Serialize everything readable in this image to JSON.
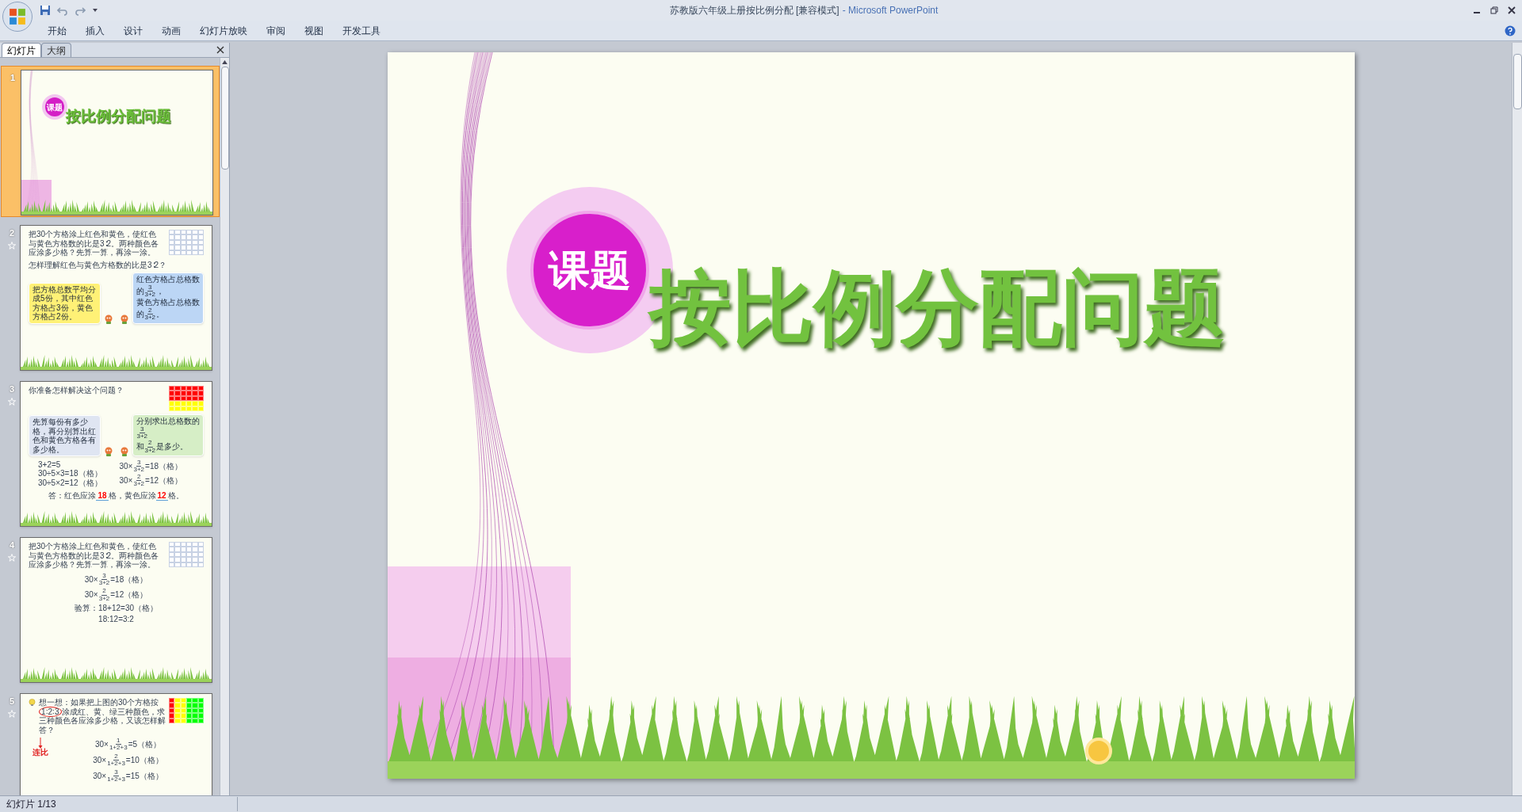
{
  "window": {
    "title": "苏教版六年级上册按比例分配 [兼容模式]",
    "app": "- Microsoft PowerPoint"
  },
  "ribbon_tabs": [
    {
      "label": "开始"
    },
    {
      "label": "插入"
    },
    {
      "label": "设计"
    },
    {
      "label": "动画"
    },
    {
      "label": "幻灯片放映"
    },
    {
      "label": "审阅"
    },
    {
      "label": "视图"
    },
    {
      "label": "开发工具"
    }
  ],
  "panel": {
    "tabs": [
      {
        "label": "幻灯片",
        "selected": true
      },
      {
        "label": "大纲",
        "selected": false
      }
    ],
    "slides": [
      {
        "number": "1",
        "selected": true,
        "animated": false,
        "kind": "title",
        "badge": "课题",
        "title": "按比例分配问题"
      },
      {
        "number": "2",
        "selected": false,
        "animated": true,
        "kind": "content",
        "blocks": [
          {
            "kind": "problem",
            "text": "把30个方格涂上红色和黄色，使红色与黄色方格数的比是3∶2。两种颜色各应涂多少格？先算一算，再涂一涂。",
            "grid": {
              "kind": "blank"
            }
          },
          {
            "kind": "question",
            "text": "怎样理解红色与黄色方格数的比是3∶2？"
          },
          {
            "kind": "bubbles",
            "items": [
              {
                "color": "#fff176",
                "lines": [
                  [
                    {
                      "kind": "text",
                      "t": "把方格总数平均分成5份，其中红色方格占3份，黄色方格占2份。"
                    }
                  ]
                ]
              },
              {
                "color": "#bcd6f5",
                "lines": [
                  [
                    {
                      "kind": "text",
                      "t": "红色方格占总格数的"
                    },
                    {
                      "kind": "fraction",
                      "num": "3",
                      "den": "3+2"
                    },
                    {
                      "kind": "text",
                      "t": "，"
                    }
                  ],
                  [
                    {
                      "kind": "text",
                      "t": "黄色方格占总格数的"
                    },
                    {
                      "kind": "fraction",
                      "num": "2",
                      "den": "3+2"
                    },
                    {
                      "kind": "text",
                      "t": "。"
                    }
                  ]
                ]
              }
            ]
          }
        ]
      },
      {
        "number": "3",
        "selected": false,
        "animated": true,
        "kind": "content",
        "blocks": [
          {
            "kind": "problem",
            "text": "你准备怎样解决这个问题？",
            "grid": {
              "kind": "two_color_rows"
            }
          },
          {
            "kind": "bubbles",
            "items": [
              {
                "color": "#dfe5f2",
                "lines": [
                  [
                    {
                      "kind": "text",
                      "t": "先算每份有多少格，再分别算出红色和黄色方格各有多少格。"
                    }
                  ]
                ]
              },
              {
                "color": "#d6eec6",
                "lines": [
                  [
                    {
                      "kind": "text",
                      "t": "分别求出总格数的"
                    },
                    {
                      "kind": "fraction",
                      "num": "3",
                      "den": "3+2"
                    }
                  ],
                  [
                    {
                      "kind": "text",
                      "t": "和"
                    },
                    {
                      "kind": "fraction",
                      "num": "2",
                      "den": "3+2"
                    },
                    {
                      "kind": "text",
                      "t": "是多少。"
                    }
                  ]
                ]
              }
            ]
          },
          {
            "kind": "columns",
            "columns": [
              [
                [
                  {
                    "kind": "text",
                    "t": "3+2=5"
                  }
                ],
                [
                  {
                    "kind": "text",
                    "t": "30÷5×3=18（格）"
                  }
                ],
                [
                  {
                    "kind": "text",
                    "t": "30÷5×2=12（格）"
                  }
                ]
              ],
              [
                [
                  {
                    "kind": "text",
                    "t": "30×"
                  },
                  {
                    "kind": "fraction",
                    "num": "3",
                    "den": "3+2"
                  },
                  {
                    "kind": "text",
                    "t": "=18（格）"
                  }
                ],
                [
                  {
                    "kind": "text",
                    "t": "30×"
                  },
                  {
                    "kind": "fraction",
                    "num": "2",
                    "den": "3+2"
                  },
                  {
                    "kind": "text",
                    "t": "=12（格）"
                  }
                ]
              ]
            ]
          },
          {
            "kind": "answer",
            "line": [
              {
                "kind": "text",
                "t": "答：红色应涂"
              },
              {
                "kind": "blank",
                "t": "18"
              },
              {
                "kind": "text",
                "t": "格，黄色应涂"
              },
              {
                "kind": "blank",
                "t": "12"
              },
              {
                "kind": "text",
                "t": "格。"
              }
            ]
          }
        ]
      },
      {
        "number": "4",
        "selected": false,
        "animated": true,
        "kind": "content",
        "blocks": [
          {
            "kind": "problem",
            "text": "把30个方格涂上红色和黄色，使红色与黄色方格数的比是3∶2。两种颜色各应涂多少格？先算一算，再涂一涂。",
            "grid": {
              "kind": "blank"
            }
          },
          {
            "kind": "equations",
            "lines": [
              [
                {
                  "kind": "text",
                  "t": "30×"
                },
                {
                  "kind": "fraction",
                  "num": "3",
                  "den": "3+2"
                },
                {
                  "kind": "text",
                  "t": "=18（格）"
                }
              ],
              [
                {
                  "kind": "text",
                  "t": "30×"
                },
                {
                  "kind": "fraction",
                  "num": "2",
                  "den": "3+2"
                },
                {
                  "kind": "text",
                  "t": "=12（格）"
                }
              ],
              [
                {
                  "kind": "text",
                  "t": "验算：18+12=30（格）"
                }
              ],
              [
                {
                  "kind": "text",
                  "t": "18:12=3:2"
                }
              ]
            ]
          }
        ]
      },
      {
        "number": "5",
        "selected": false,
        "animated": true,
        "kind": "content",
        "blocks": [
          {
            "kind": "think",
            "before": "想一想：如果把上图的30个方格按",
            "ratio": "1∶2∶3",
            "after": "涂成红、黄、绿三种颜色，求三种颜色各应涂多少格，又该怎样解答？",
            "grid": {
              "kind": "three_color_columns"
            }
          },
          {
            "kind": "equations",
            "note": "连比",
            "lines": [
              [
                {
                  "kind": "text",
                  "t": "30×"
                },
                {
                  "kind": "fraction",
                  "num": "1",
                  "den": "1+2+3"
                },
                {
                  "kind": "text",
                  "t": "=5（格）"
                }
              ],
              [
                {
                  "kind": "text",
                  "t": "30×"
                },
                {
                  "kind": "fraction",
                  "num": "2",
                  "den": "1+2+3"
                },
                {
                  "kind": "text",
                  "t": "=10（格）"
                }
              ],
              [
                {
                  "kind": "text",
                  "t": "30×"
                },
                {
                  "kind": "fraction",
                  "num": "3",
                  "den": "1+2+3"
                },
                {
                  "kind": "text",
                  "t": "=15（格）"
                }
              ]
            ]
          }
        ]
      }
    ]
  },
  "slide": {
    "badge": "课题",
    "title": "按比例分配问题"
  },
  "status_bar": {
    "text": "幻灯片 1/13"
  }
}
